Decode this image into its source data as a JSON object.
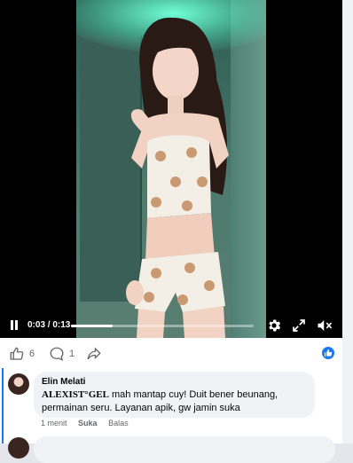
{
  "video": {
    "time_display": "0:03 / 0:13",
    "progress": 0.23,
    "icons": {
      "play_pause": "pause-icon",
      "settings": "gear-icon",
      "fullscreen": "expand-icon",
      "volume": "mute-icon"
    }
  },
  "actions": {
    "like_count": "6",
    "comment_count": "1",
    "icons": [
      "like-icon",
      "comment-icon",
      "share-icon",
      "like-reaction-icon"
    ],
    "accent": "#1877f2"
  },
  "comment": {
    "author": "Elin Melati",
    "text_bold": "ALEXIST°GEL",
    "text_rest": " mah mantap cuy! Duit bener beunang, permainan seru. Layanan apik, gw jamin suka",
    "time": "1 menit",
    "like_label": "Suka",
    "reply_label": "Balas"
  }
}
